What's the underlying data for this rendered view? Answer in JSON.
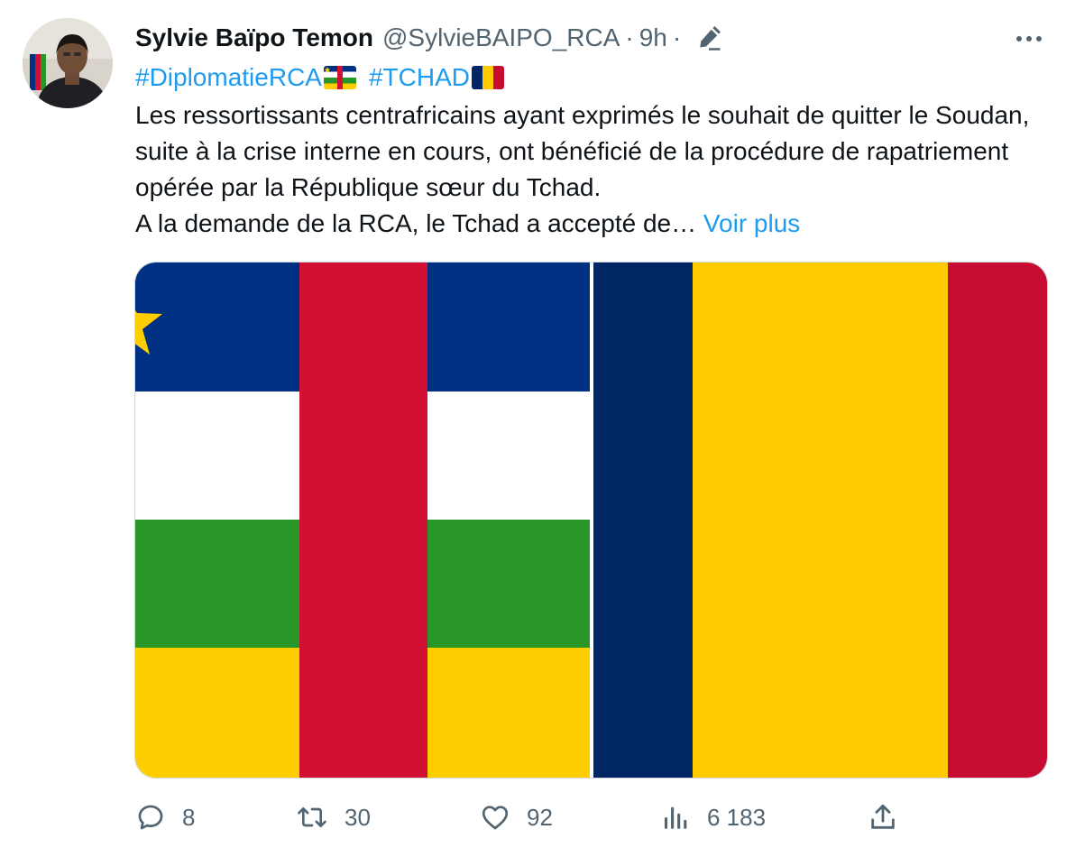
{
  "author": {
    "name": "Sylvie Baïpo Temon",
    "handle": "@SylvieBAIPO_RCA",
    "separator": "·",
    "time": "9h"
  },
  "hashtags": [
    {
      "text": "#DiplomatieRCA",
      "flag": "central-african-republic-flag"
    },
    {
      "text": "#TCHAD",
      "flag": "chad-flag"
    }
  ],
  "text": {
    "paragraph1": "Les ressortissants centrafricains ayant exprimés le souhait de quitter le Soudan, suite à la crise interne en cours, ont bénéficié de la procédure de rapatriement opérée par la République sœur du Tchad.",
    "paragraph2": "A la demande de la RCA, le Tchad a accepté de…",
    "more_link": "Voir plus"
  },
  "media": [
    {
      "name": "central-african-republic-flag-image"
    },
    {
      "name": "chad-flag-image"
    }
  ],
  "actions": {
    "replies": "8",
    "retweets": "30",
    "likes": "92",
    "views": "6 183"
  },
  "colors": {
    "accent": "#1d9bf0",
    "text": "#0f1419",
    "secondary": "#536471",
    "car_blue": "#003082",
    "car_white": "#ffffff",
    "car_green": "#289728",
    "car_yellow": "#ffce00",
    "car_red": "#d21034",
    "chad_blue": "#002664",
    "chad_yellow": "#fecb00",
    "chad_red": "#c60c30"
  }
}
